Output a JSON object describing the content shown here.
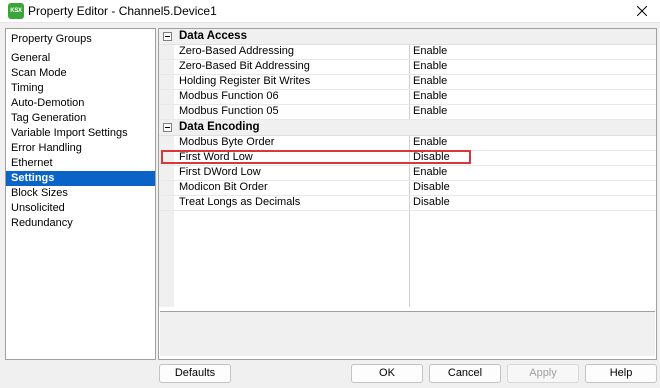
{
  "window": {
    "title": "Property Editor - Channel5.Device1",
    "app_icon_label": "KSX",
    "close_icon": "close-icon"
  },
  "sidebar": {
    "items": [
      {
        "label": "Property Groups"
      },
      {
        "label": "General"
      },
      {
        "label": "Scan Mode"
      },
      {
        "label": "Timing"
      },
      {
        "label": "Auto-Demotion"
      },
      {
        "label": "Tag Generation"
      },
      {
        "label": "Variable Import Settings"
      },
      {
        "label": "Error Handling"
      },
      {
        "label": "Ethernet"
      },
      {
        "label": "Settings"
      },
      {
        "label": "Block Sizes"
      },
      {
        "label": "Unsolicited"
      },
      {
        "label": "Redundancy"
      }
    ],
    "selected": "Settings",
    "selected_color": "#0a64c8"
  },
  "property_grid": {
    "groups": [
      {
        "label": "Data Access",
        "rows": [
          {
            "name": "Zero-Based Addressing",
            "value": "Enable"
          },
          {
            "name": "Zero-Based Bit Addressing",
            "value": "Enable"
          },
          {
            "name": "Holding Register Bit Writes",
            "value": "Enable"
          },
          {
            "name": "Modbus Function 06",
            "value": "Enable"
          },
          {
            "name": "Modbus Function 05",
            "value": "Enable"
          }
        ]
      },
      {
        "label": "Data Encoding",
        "rows": [
          {
            "name": "Modbus Byte Order",
            "value": "Enable"
          },
          {
            "name": "First Word Low",
            "value": "Disable"
          },
          {
            "name": "First DWord Low",
            "value": "Enable"
          },
          {
            "name": "Modicon Bit Order",
            "value": "Disable"
          },
          {
            "name": "Treat Longs as Decimals",
            "value": "Disable"
          }
        ]
      }
    ],
    "highlighted_row": "First Word Low",
    "highlight_color": "#d8383b"
  },
  "buttons": {
    "defaults": "Defaults",
    "ok": "OK",
    "cancel": "Cancel",
    "apply": "Apply",
    "help": "Help"
  }
}
